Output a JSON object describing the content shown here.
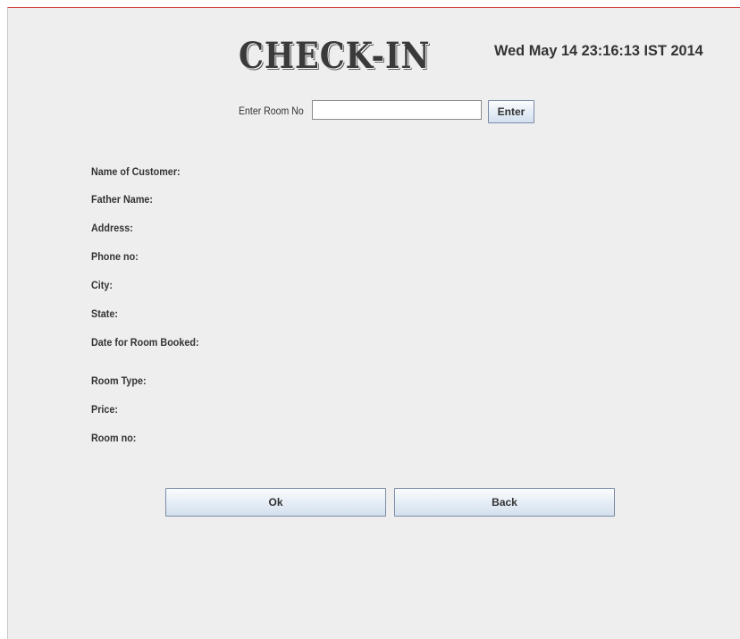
{
  "header": {
    "title": "CHECK-IN",
    "datetime": "Wed May 14 23:16:13 IST 2014"
  },
  "room_search": {
    "label": "Enter Room No",
    "input_value": "",
    "enter_label": "Enter"
  },
  "fields": {
    "customer_name": "Name of Customer:",
    "father_name": "Father Name:",
    "address": "Address:",
    "phone": "Phone no:",
    "city": "City:",
    "state": "State:",
    "date_booked": "Date for Room Booked:",
    "room_type": "Room Type:",
    "price": "Price:",
    "room_no": "Room no:"
  },
  "actions": {
    "ok_label": "Ok",
    "back_label": "Back"
  }
}
